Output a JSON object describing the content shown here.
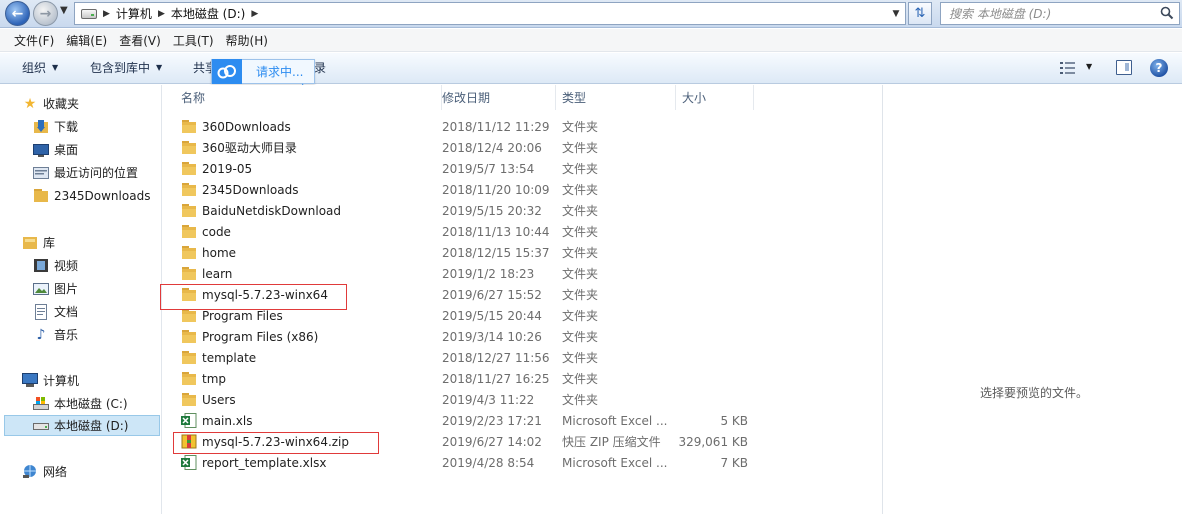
{
  "window": {
    "breadcrumb": [
      "计算机",
      "本地磁盘 (D:)"
    ],
    "search_placeholder": "搜索 本地磁盘 (D:)"
  },
  "menu": [
    "文件(F)",
    "编辑(E)",
    "查看(V)",
    "工具(T)",
    "帮助(H)"
  ],
  "toolbar": {
    "organize": "组织",
    "include_library": "包含到库中",
    "share_partial": "共享",
    "share_tail": "录"
  },
  "baidu_popup": {
    "text": "请求中..."
  },
  "nav": {
    "favorites": {
      "label": "收藏夹",
      "items": [
        "下载",
        "桌面",
        "最近访问的位置",
        "2345Downloads"
      ]
    },
    "libraries": {
      "label": "库",
      "items": [
        "视频",
        "图片",
        "文档",
        "音乐"
      ]
    },
    "computer": {
      "label": "计算机",
      "items": [
        "本地磁盘 (C:)",
        "本地磁盘 (D:)"
      ],
      "selected": "本地磁盘 (D:)"
    },
    "network": {
      "label": "网络"
    }
  },
  "columns": {
    "name": "名称",
    "date": "修改日期",
    "type": "类型",
    "size": "大小"
  },
  "files": [
    {
      "name": "360Downloads",
      "date": "2018/11/12 11:29",
      "type": "文件夹",
      "size": "",
      "kind": "folder"
    },
    {
      "name": "360驱动大师目录",
      "date": "2018/12/4 20:06",
      "type": "文件夹",
      "size": "",
      "kind": "folder"
    },
    {
      "name": "2019-05",
      "date": "2019/5/7 13:54",
      "type": "文件夹",
      "size": "",
      "kind": "folder"
    },
    {
      "name": "2345Downloads",
      "date": "2018/11/20 10:09",
      "type": "文件夹",
      "size": "",
      "kind": "folder"
    },
    {
      "name": "BaiduNetdiskDownload",
      "date": "2019/5/15 20:32",
      "type": "文件夹",
      "size": "",
      "kind": "folder"
    },
    {
      "name": "code",
      "date": "2018/11/13 10:44",
      "type": "文件夹",
      "size": "",
      "kind": "folder"
    },
    {
      "name": "home",
      "date": "2018/12/15 15:37",
      "type": "文件夹",
      "size": "",
      "kind": "folder"
    },
    {
      "name": "learn",
      "date": "2019/1/2 18:23",
      "type": "文件夹",
      "size": "",
      "kind": "folder"
    },
    {
      "name": "mysql-5.7.23-winx64",
      "date": "2019/6/27 15:52",
      "type": "文件夹",
      "size": "",
      "kind": "folder",
      "highlighted": true
    },
    {
      "name": "Program Files",
      "date": "2019/5/15 20:44",
      "type": "文件夹",
      "size": "",
      "kind": "folder"
    },
    {
      "name": "Program Files (x86)",
      "date": "2019/3/14 10:26",
      "type": "文件夹",
      "size": "",
      "kind": "folder"
    },
    {
      "name": "template",
      "date": "2018/12/27 11:56",
      "type": "文件夹",
      "size": "",
      "kind": "folder"
    },
    {
      "name": "tmp",
      "date": "2018/11/27 16:25",
      "type": "文件夹",
      "size": "",
      "kind": "folder"
    },
    {
      "name": "Users",
      "date": "2019/4/3 11:22",
      "type": "文件夹",
      "size": "",
      "kind": "folder"
    },
    {
      "name": "main.xls",
      "date": "2019/2/23 17:21",
      "type": "Microsoft Excel ...",
      "size": "5 KB",
      "kind": "excel"
    },
    {
      "name": "mysql-5.7.23-winx64.zip",
      "date": "2019/6/27 14:02",
      "type": "快压 ZIP 压缩文件",
      "size": "329,061 KB",
      "kind": "zip",
      "highlighted": true
    },
    {
      "name": "report_template.xlsx",
      "date": "2019/4/28 8:54",
      "type": "Microsoft Excel ...",
      "size": "7 KB",
      "kind": "excel"
    }
  ],
  "preview": {
    "empty_text": "选择要预览的文件。"
  },
  "colors": {
    "selection": "#cde6f7",
    "highlight_box": "#e03a3a",
    "folder": "#e8b84a",
    "baidu": "#2d8cf0"
  }
}
